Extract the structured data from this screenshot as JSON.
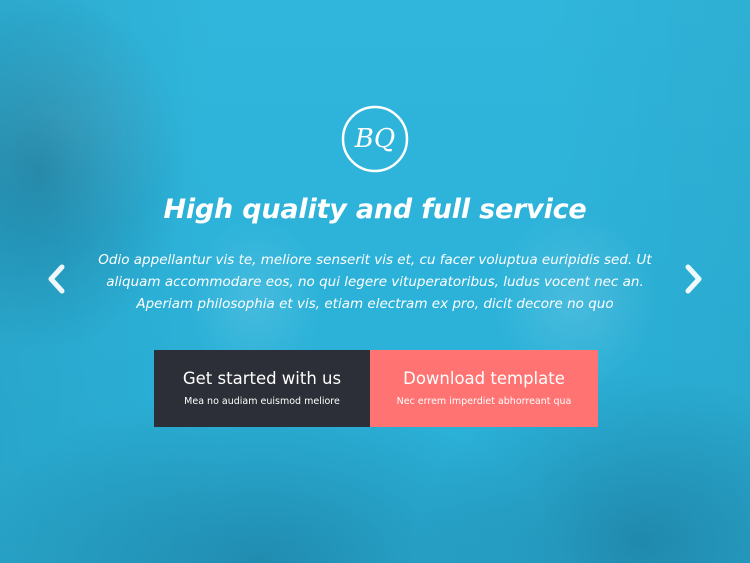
{
  "hero": {
    "logo_text": "BQ",
    "headline": "High quality and full service",
    "lead": "Odio appellantur vis te, meliore senserit vis et, cu facer voluptua euripidis sed. Ut aliquam accommodare eos, no qui legere vituperatoribus, ludus vocent nec an. Aperiam philosophia et vis, etiam electram ex pro, dicit decore no quo",
    "prev_icon": "chevron-left-icon",
    "next_icon": "chevron-right-icon"
  },
  "cta": {
    "primary": {
      "title": "Get started with us",
      "subtitle": "Mea no audiam euismod meliore"
    },
    "secondary": {
      "title": "Download template",
      "subtitle": "Nec errem imperdiet abhorreant qua"
    }
  },
  "colors": {
    "background": "#2bb3d9",
    "dark_button": "#2c2f37",
    "coral_button": "#ff7373",
    "text": "#ffffff"
  }
}
